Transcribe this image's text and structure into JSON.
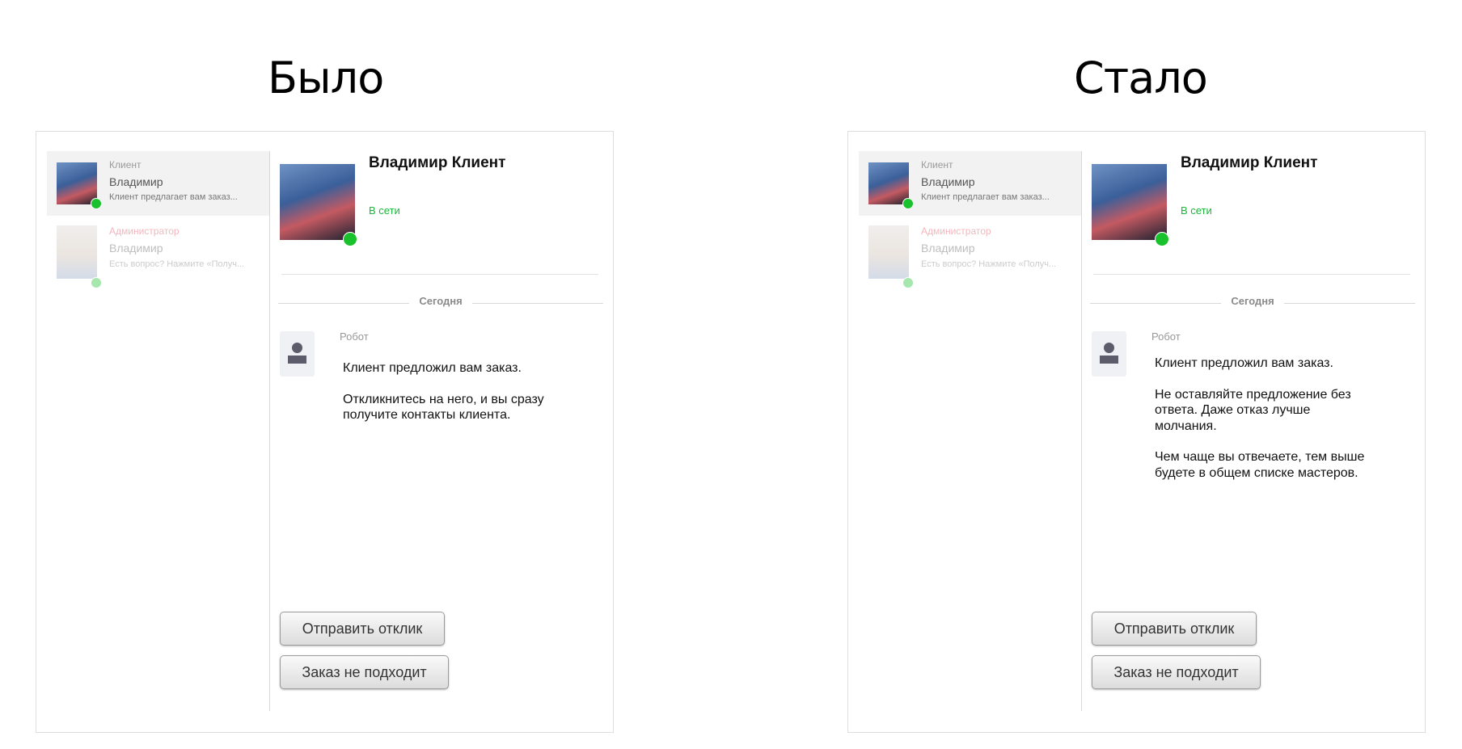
{
  "before": {
    "heading": "Было",
    "contacts": [
      {
        "role": "Клиент",
        "name": "Владимир",
        "preview": "Клиент предлагает вам заказ..."
      },
      {
        "role": "Администратор",
        "name": "Владимир",
        "preview": "Есть вопрос? Нажмите «Получ..."
      }
    ],
    "chat": {
      "name": "Владимир Клиент",
      "status": "В сети",
      "date_separator": "Сегодня",
      "sender": "Робот",
      "message": [
        "Клиент предложил вам заказ.",
        "Откликнитесь на него, и вы сразу получите контакты клиента."
      ],
      "buttons": {
        "send": "Отправить отклик",
        "reject": "Заказ не подходит"
      }
    }
  },
  "after": {
    "heading": "Стало",
    "contacts": [
      {
        "role": "Клиент",
        "name": "Владимир",
        "preview": "Клиент предлагает вам заказ..."
      },
      {
        "role": "Администратор",
        "name": "Владимир",
        "preview": "Есть вопрос? Нажмите «Получ..."
      }
    ],
    "chat": {
      "name": "Владимир Клиент",
      "status": "В сети",
      "date_separator": "Сегодня",
      "sender": "Робот",
      "message": [
        "Клиент предложил вам заказ.",
        "Не оставляйте предложение без ответа. Даже отказ лучше молчания.",
        "Чем чаще вы отвечаете, тем выше будете в общем списке мастеров."
      ],
      "buttons": {
        "send": "Отправить отклик",
        "reject": "Заказ не подходит"
      }
    }
  },
  "colors": {
    "online": "#19c22c",
    "admin_role": "#e13d4e"
  }
}
